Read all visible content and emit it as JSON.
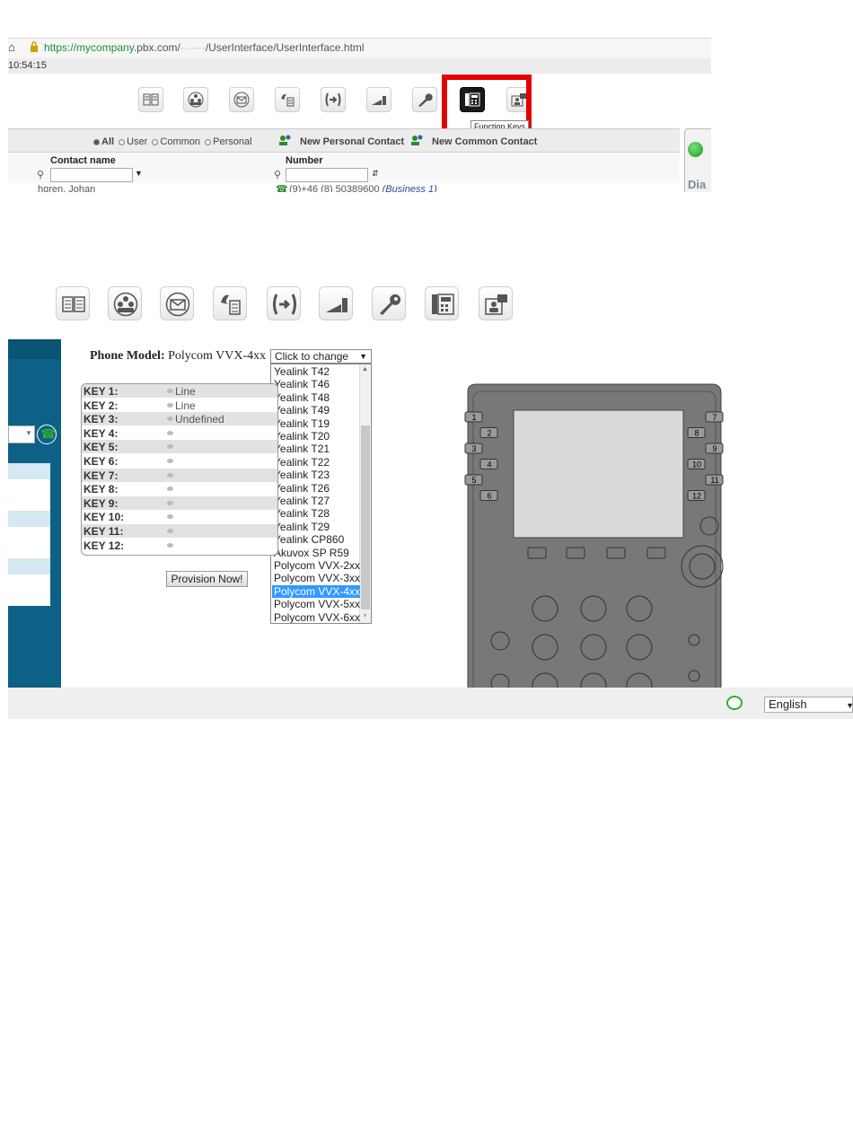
{
  "top_screenshot": {
    "url": {
      "prefix": "https://",
      "host_highlight": "mycompany",
      "rest": ".pbx.com/",
      "path": "/UserInterface/UserInterface.html"
    },
    "clock": "10:54:15",
    "toolbar_icons": [
      "phonebook-icon",
      "conference-icon",
      "voicemail-icon",
      "fax-icon",
      "call-forward-icon",
      "statistics-icon",
      "settings-icon",
      "function-keys-icon",
      "profile-icon"
    ],
    "tooltip": "Function Keys",
    "filters": {
      "all": "All",
      "user": "User",
      "common": "Common",
      "personal": "Personal",
      "selected": "All"
    },
    "new_personal_contact": "New Personal Contact",
    "new_common_contact": "New Common Contact",
    "columns": {
      "contact_name": "Contact name",
      "number": "Number"
    },
    "first_row": {
      "name": "hgren, Johan",
      "number": "(9)+46 (8) 50389600",
      "number_type": "(Business 1)"
    },
    "side_card": {
      "label": "Dia"
    }
  },
  "toolbar2_icons": [
    "phonebook-icon",
    "conference-icon",
    "voicemail-icon",
    "fax-icon",
    "call-forward-icon",
    "statistics-icon",
    "settings-icon",
    "function-keys-icon",
    "profile-icon"
  ],
  "function_keys_page": {
    "phone_model_label": "Phone Model:",
    "phone_model_value": "Polycom VVX-4xx",
    "select_placeholder": "Click to change",
    "dropdown_options": [
      "Yealink T42",
      "Yealink T46",
      "Yealink T48",
      "Yealink T49",
      "Yealink T19",
      "Yealink T20",
      "Yealink T21",
      "Yealink T22",
      "Yealink T23",
      "Yealink T26",
      "Yealink T27",
      "Yealink T28",
      "Yealink T29",
      "Yealink CP860",
      "Akuvox SP R59",
      "Polycom VVX-2xx",
      "Polycom VVX-3xx",
      "Polycom VVX-4xx",
      "Polycom VVX-5xx",
      "Polycom VVX-6xx"
    ],
    "selected_option": "Polycom VVX-4xx",
    "keys": [
      {
        "label": "KEY 1:",
        "value": "Line"
      },
      {
        "label": "KEY 2:",
        "value": "Line"
      },
      {
        "label": "KEY 3:",
        "value": "Undefined"
      },
      {
        "label": "KEY 4:",
        "value": ""
      },
      {
        "label": "KEY 5:",
        "value": ""
      },
      {
        "label": "KEY 6:",
        "value": ""
      },
      {
        "label": "KEY 7:",
        "value": ""
      },
      {
        "label": "KEY 8:",
        "value": ""
      },
      {
        "label": "KEY 9:",
        "value": ""
      },
      {
        "label": "KEY 10:",
        "value": ""
      },
      {
        "label": "KEY 11:",
        "value": ""
      },
      {
        "label": "KEY 12:",
        "value": ""
      }
    ],
    "provision_button": "Provision Now!",
    "phone_keys_left": [
      "1",
      "2",
      "3",
      "4",
      "5",
      "6"
    ],
    "phone_keys_right": [
      "7",
      "8",
      "9",
      "10",
      "11",
      "12"
    ],
    "language": "English"
  },
  "colors": {
    "highlight_red": "#e50000",
    "sidebar_blue": "#0d6186",
    "selection_blue": "#3399ff",
    "online_green": "#2fae2f"
  }
}
